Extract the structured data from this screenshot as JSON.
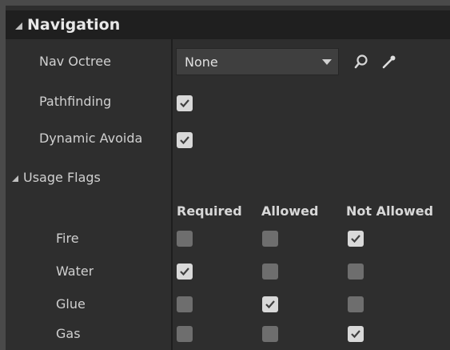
{
  "section": {
    "title": "Navigation"
  },
  "properties": {
    "nav_octree": {
      "label": "Nav Octree",
      "value": "None"
    },
    "pathfinding": {
      "label": "Pathfinding",
      "checked": true
    },
    "dynamic_avoidance": {
      "label": "Dynamic Avoida",
      "checked": true
    }
  },
  "usage_flags": {
    "label": "Usage Flags",
    "columns": [
      "Required",
      "Allowed",
      "Not Allowed"
    ],
    "rows": [
      {
        "name": "Fire",
        "required": false,
        "allowed": false,
        "not_allowed": true
      },
      {
        "name": "Water",
        "required": true,
        "allowed": false,
        "not_allowed": false
      },
      {
        "name": "Glue",
        "required": false,
        "allowed": true,
        "not_allowed": false
      },
      {
        "name": "Gas",
        "required": false,
        "allowed": false,
        "not_allowed": true
      }
    ]
  },
  "icons": {
    "browse": "search-icon",
    "pick": "eyedropper-icon"
  },
  "colors": {
    "panel": "#2e2e2e",
    "header": "#1f1f1f",
    "checkbox_on": "#d9d9d9",
    "checkbox_off": "#6e6e6e"
  }
}
